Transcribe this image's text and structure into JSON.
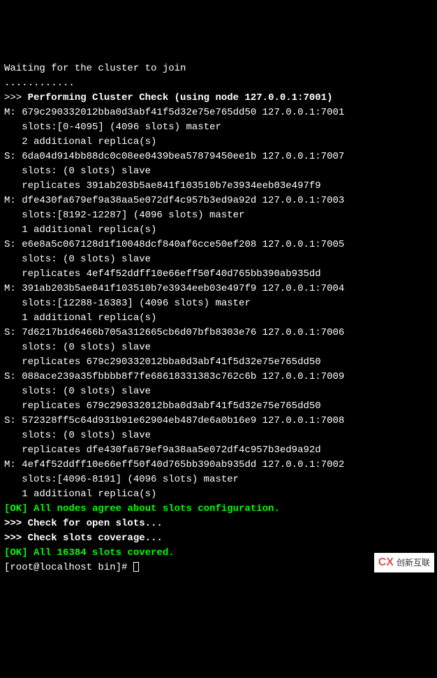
{
  "wait_msg": "Waiting for the cluster to join",
  "dots": "............",
  "check_line_prefix": ">>> ",
  "check_line_bold": "Performing Cluster Check (using node 127.0.0.1:7001)",
  "nodes": [
    {
      "role": "M",
      "id": "679c290332012bba0d3abf41f5d32e75e765dd50",
      "addr": "127.0.0.1:7001",
      "slots": "slots:[0-4095] (4096 slots) master",
      "extra": "2 additional replica(s)"
    },
    {
      "role": "S",
      "id": "6da04d914bb88dc0c08ee0439bea57879450ee1b",
      "addr": "127.0.0.1:7007",
      "slots": "slots: (0 slots) slave",
      "extra": "replicates 391ab203b5ae841f103510b7e3934eeb03e497f9"
    },
    {
      "role": "M",
      "id": "dfe430fa679ef9a38aa5e072df4c957b3ed9a92d",
      "addr": "127.0.0.1:7003",
      "slots": "slots:[8192-12287] (4096 slots) master",
      "extra": "1 additional replica(s)"
    },
    {
      "role": "S",
      "id": "e6e8a5c067128d1f10048dcf840af6cce50ef208",
      "addr": "127.0.0.1:7005",
      "slots": "slots: (0 slots) slave",
      "extra": "replicates 4ef4f52ddff10e66eff50f40d765bb390ab935dd"
    },
    {
      "role": "M",
      "id": "391ab203b5ae841f103510b7e3934eeb03e497f9",
      "addr": "127.0.0.1:7004",
      "slots": "slots:[12288-16383] (4096 slots) master",
      "extra": "1 additional replica(s)"
    },
    {
      "role": "S",
      "id": "7d6217b1d6466b705a312665cb6d07bfb8303e76",
      "addr": "127.0.0.1:7006",
      "slots": "slots: (0 slots) slave",
      "extra": "replicates 679c290332012bba0d3abf41f5d32e75e765dd50"
    },
    {
      "role": "S",
      "id": "088ace239a35fbbbb8f7fe68618331383c762c6b",
      "addr": "127.0.0.1:7009",
      "slots": "slots: (0 slots) slave",
      "extra": "replicates 679c290332012bba0d3abf41f5d32e75e765dd50"
    },
    {
      "role": "S",
      "id": "572328ff5c64d931b91e62904eb487de6a0b16e9",
      "addr": "127.0.0.1:7008",
      "slots": "slots: (0 slots) slave",
      "extra": "replicates dfe430fa679ef9a38aa5e072df4c957b3ed9a92d"
    },
    {
      "role": "M",
      "id": "4ef4f52ddff10e66eff50f40d765bb390ab935dd",
      "addr": "127.0.0.1:7002",
      "slots": "slots:[4096-8191] (4096 slots) master",
      "extra": "1 additional replica(s)"
    }
  ],
  "ok1": "[OK] All nodes agree about slots configuration.",
  "check_open": ">>> Check for open slots...",
  "check_cov": ">>> Check slots coverage...",
  "ok2": "[OK] All 16384 slots covered.",
  "prompt": "[root@localhost bin]# ",
  "watermark": {
    "logo": "CX",
    "text": "创新互联"
  }
}
